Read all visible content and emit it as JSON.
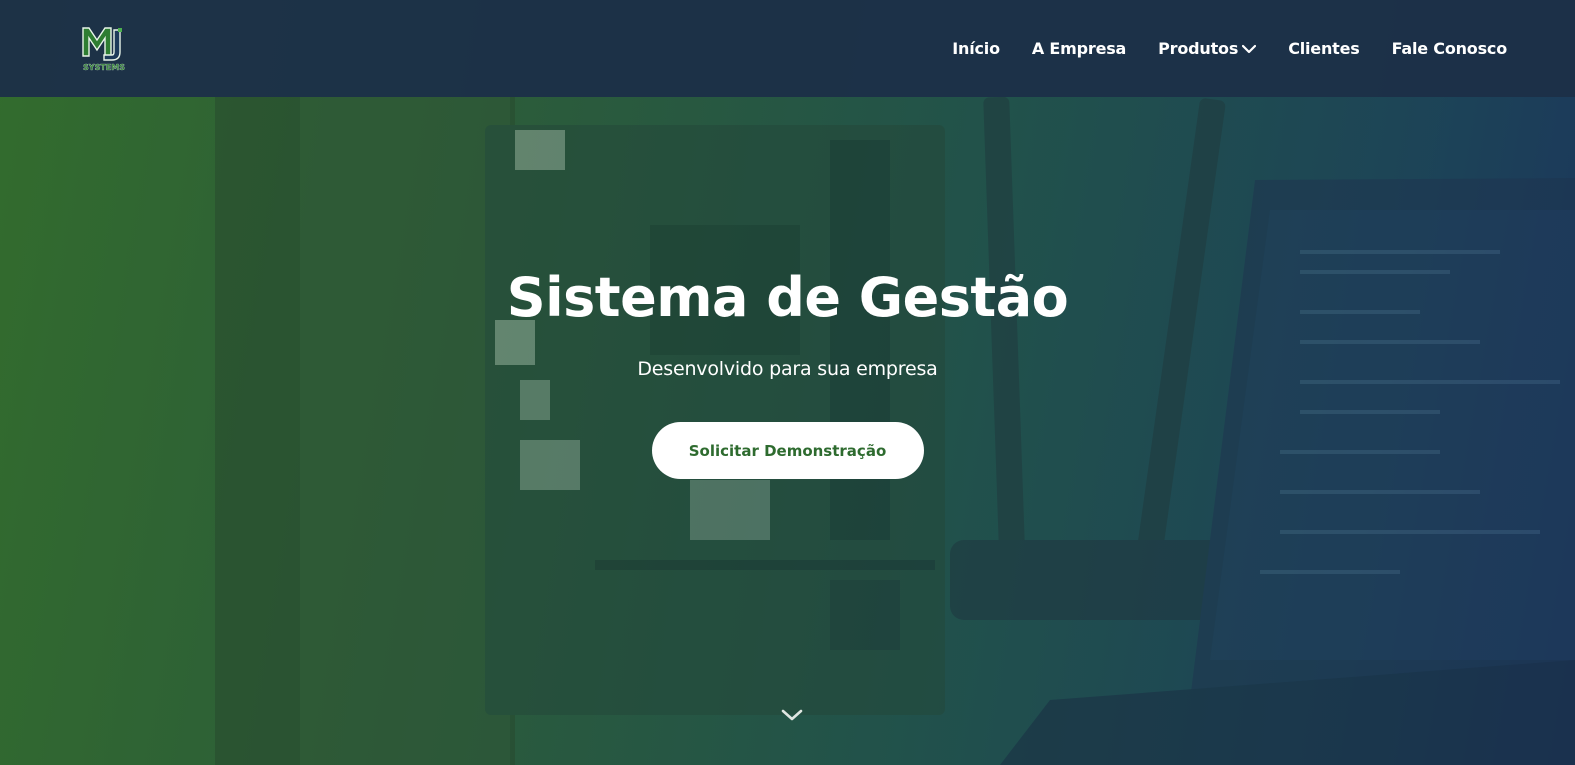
{
  "brand": {
    "logo_text": "MJ",
    "logo_sub": "SYSTEMS",
    "accent": "#2e6b2f"
  },
  "nav": [
    {
      "label": "Início"
    },
    {
      "label": "A Empresa"
    },
    {
      "label": "Produtos",
      "icon": "chevron-down-icon"
    },
    {
      "label": "Clientes"
    },
    {
      "label": "Fale Conosco"
    }
  ],
  "hero": {
    "title": "Sistema de Gestão",
    "subtitle": "Desenvolvido para sua empresa",
    "cta_label": "Solicitar Demonstração",
    "scroll_icon": "chevron-down-icon"
  }
}
